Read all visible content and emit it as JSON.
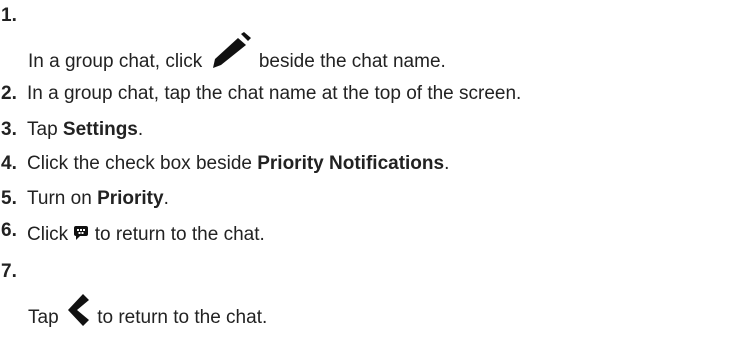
{
  "steps": [
    {
      "number": "1.",
      "before": "In a group chat, click ",
      "icon": "pencil-icon",
      "after": " beside the chat name."
    },
    {
      "number": "2.",
      "text": "In a group chat, tap the chat name at the top of the screen."
    },
    {
      "number": "3.",
      "before": "Tap ",
      "bold": "Settings",
      "after": "."
    },
    {
      "number": "4.",
      "before": "Click the check box beside ",
      "bold": "Priority Notifications",
      "after": "."
    },
    {
      "number": "5.",
      "before": "Turn on ",
      "bold": "Priority",
      "after": "."
    },
    {
      "number": "6.",
      "before": "Click ",
      "icon": "chat-bubble-icon",
      "after": " to return to the chat."
    },
    {
      "number": "7.",
      "before": "Tap ",
      "icon": "back-chevron-icon",
      "after": " to return to the chat."
    }
  ]
}
